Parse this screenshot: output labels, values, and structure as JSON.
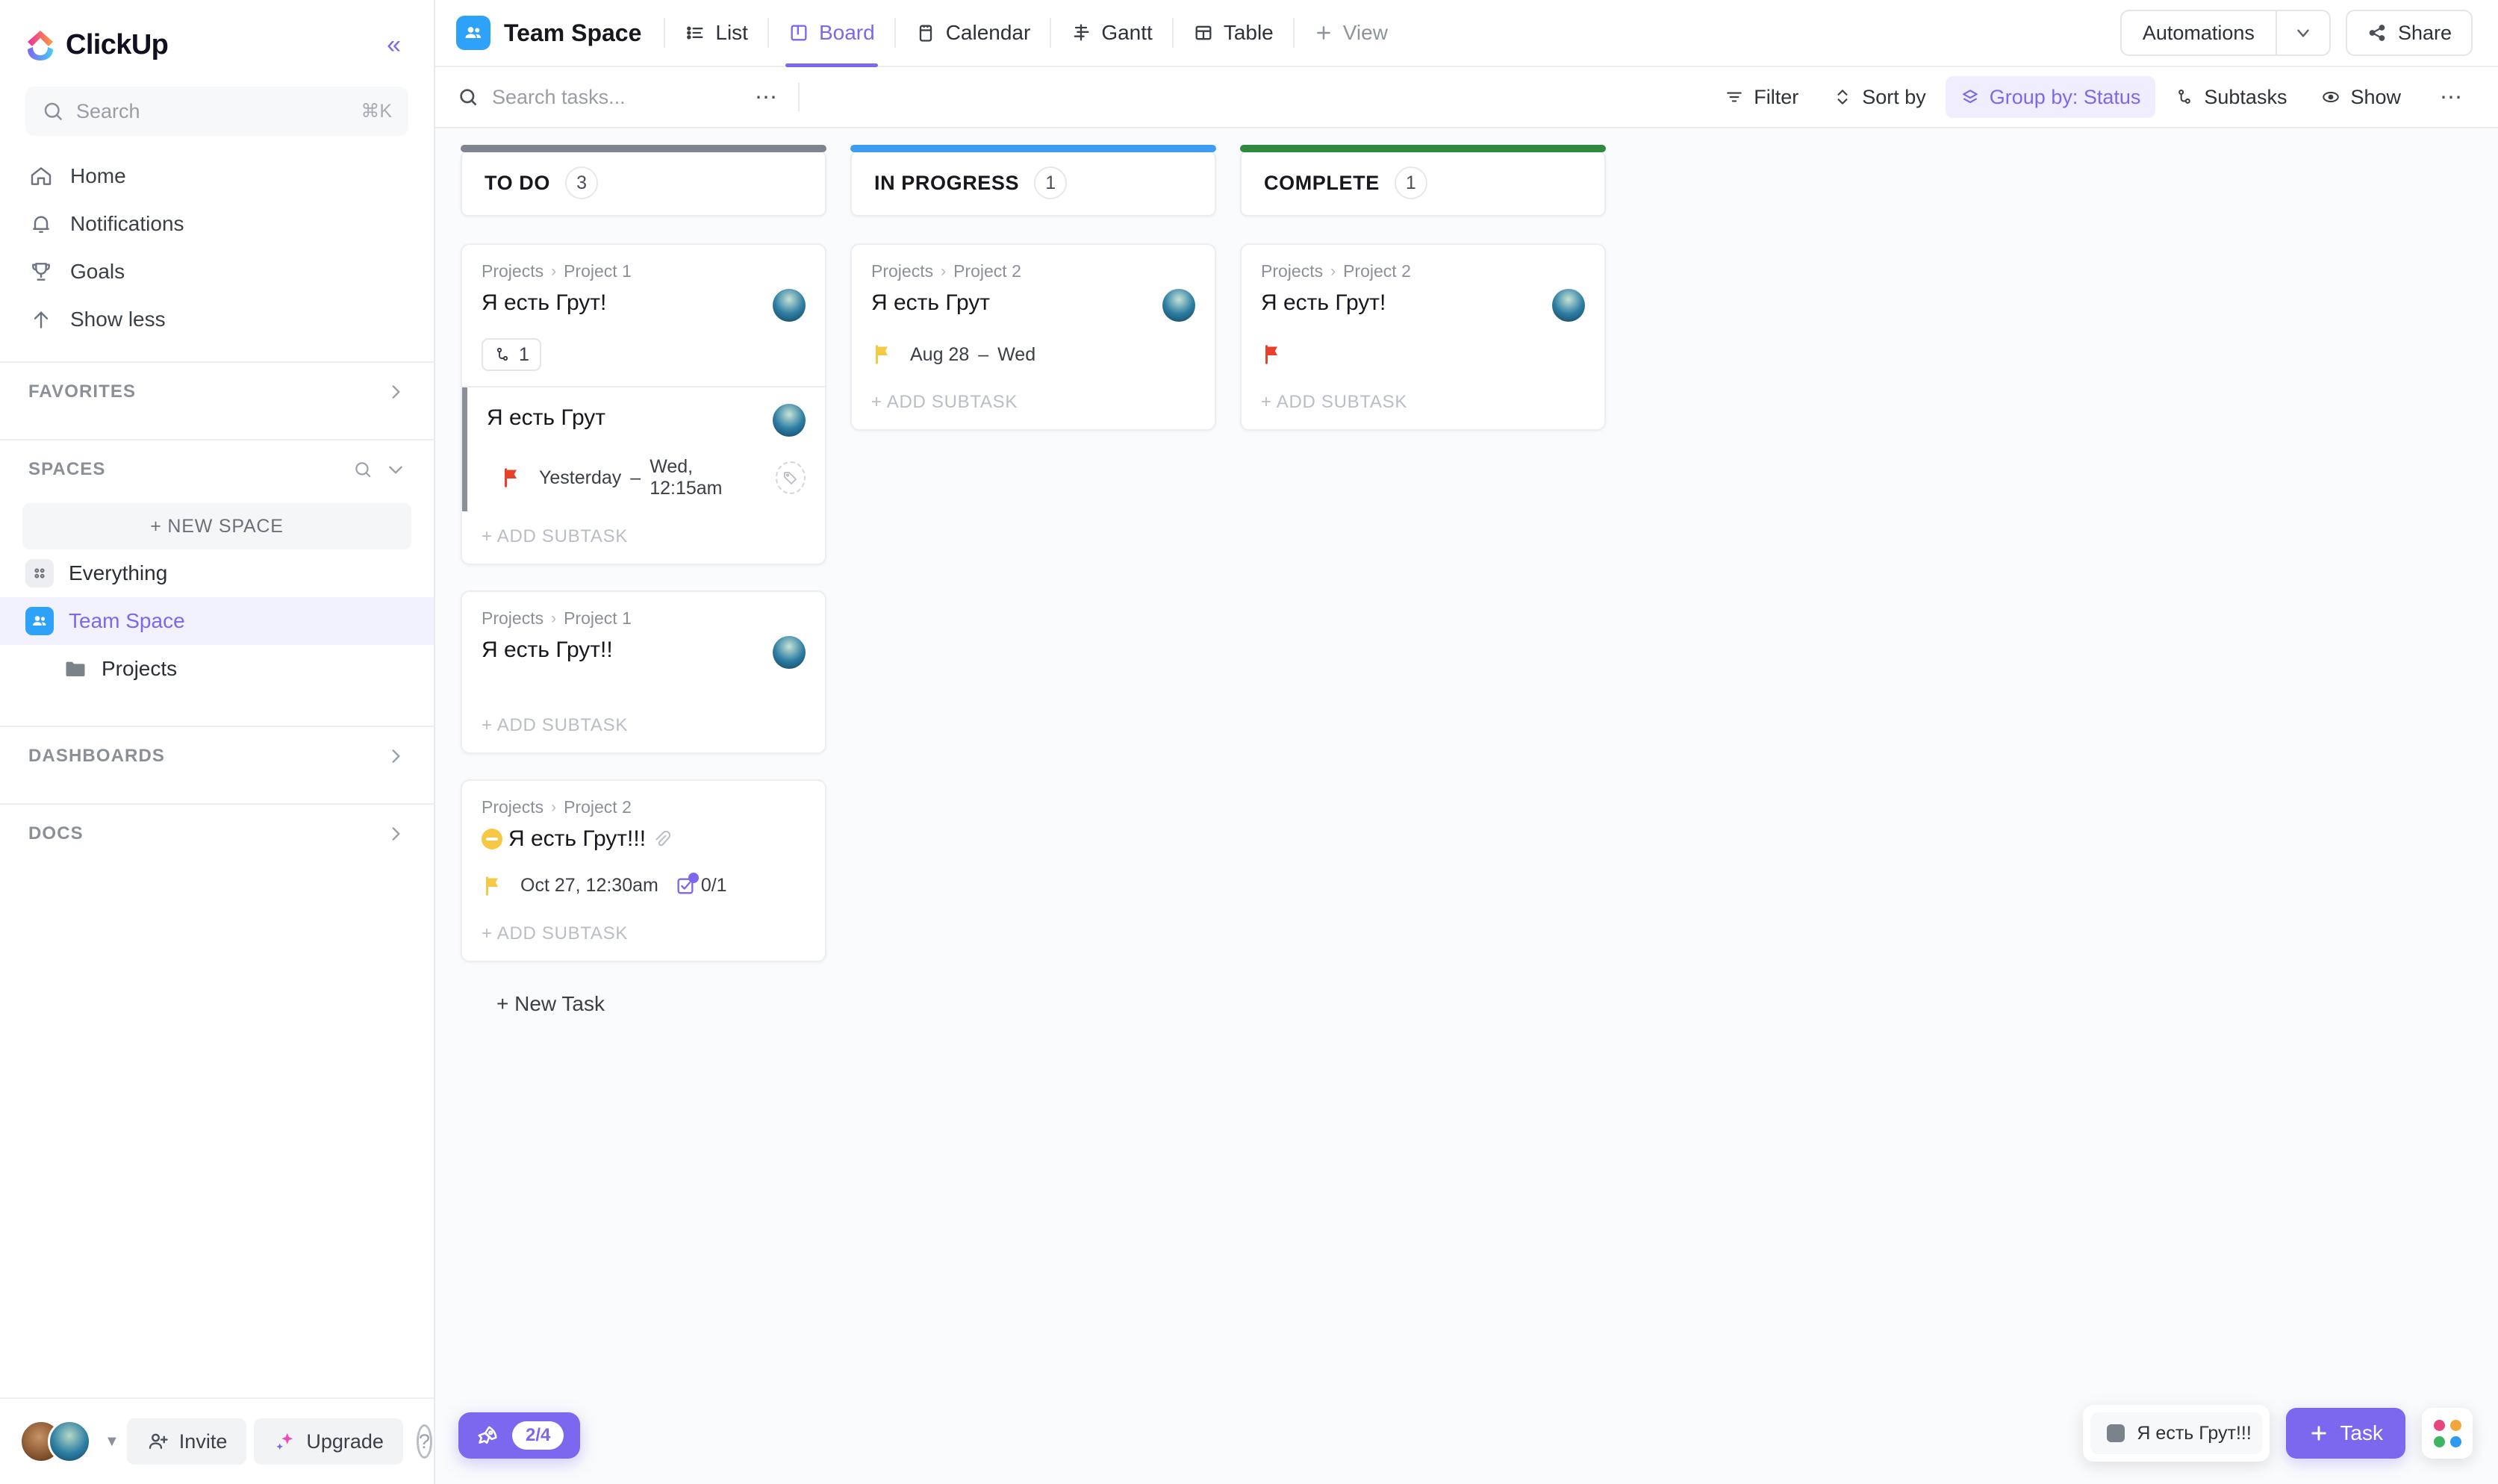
{
  "sidebar": {
    "brand": "ClickUp",
    "collapse_icon": "chevrons-left-icon",
    "search": {
      "placeholder": "Search",
      "shortcut": "⌘K",
      "icon": "search-icon"
    },
    "nav": [
      {
        "label": "Home",
        "icon": "home-icon"
      },
      {
        "label": "Notifications",
        "icon": "bell-icon"
      },
      {
        "label": "Goals",
        "icon": "trophy-icon"
      },
      {
        "label": "Show less",
        "icon": "arrow-up-icon"
      }
    ],
    "sections": {
      "favorites": {
        "label": "FAVORITES",
        "chevron": "chevron-right-icon"
      },
      "spaces": {
        "label": "SPACES",
        "search_icon": "search-icon",
        "chevron": "chevron-down-icon"
      },
      "dashboards": {
        "label": "DASHBOARDS",
        "chevron": "chevron-right-icon"
      },
      "docs": {
        "label": "DOCS",
        "chevron": "chevron-right-icon"
      }
    },
    "new_space": "+ NEW SPACE",
    "spaces": [
      {
        "label": "Everything",
        "icon": "grid-dots-icon",
        "active": false
      },
      {
        "label": "Team Space",
        "icon": "people-icon",
        "active": true
      }
    ],
    "folder": {
      "label": "Projects",
      "icon": "folder-icon"
    },
    "footer": {
      "invite": "Invite",
      "invite_icon": "user-plus-icon",
      "upgrade": "Upgrade",
      "upgrade_icon": "sparkle-icon",
      "help_icon": "question-circle-icon",
      "avatar_caret": "caret-down-icon"
    }
  },
  "topbar": {
    "space_name": "Team Space",
    "space_icon": "people-icon",
    "views": [
      {
        "label": "List",
        "icon": "list-icon",
        "active": false
      },
      {
        "label": "Board",
        "icon": "board-icon",
        "active": true
      },
      {
        "label": "Calendar",
        "icon": "calendar-icon",
        "active": false
      },
      {
        "label": "Gantt",
        "icon": "gantt-icon",
        "active": false
      },
      {
        "label": "Table",
        "icon": "table-icon",
        "active": false
      },
      {
        "label": "View",
        "icon": "plus-icon",
        "active": false
      }
    ],
    "automations": "Automations",
    "automations_caret": "chevron-down-icon",
    "share": "Share",
    "share_icon": "share-icon"
  },
  "subbar": {
    "search_placeholder": "Search tasks...",
    "search_icon": "search-icon",
    "more_icon": "ellipsis-icon",
    "controls": [
      {
        "label": "Filter",
        "icon": "filter-icon",
        "active": false
      },
      {
        "label": "Sort by",
        "icon": "sort-icon",
        "active": false
      },
      {
        "label": "Group by: Status",
        "icon": "layers-icon",
        "active": true
      },
      {
        "label": "Subtasks",
        "icon": "subtask-icon",
        "active": false
      },
      {
        "label": "Show",
        "icon": "eye-icon",
        "active": false
      }
    ],
    "overflow_icon": "ellipsis-icon"
  },
  "board": {
    "new_task_label": "+ New Task",
    "add_subtask_label": "+ ADD SUBTASK",
    "columns": [
      {
        "title": "TO DO",
        "count": "3",
        "accent": "#808490",
        "cards": [
          {
            "breadcrumb_root": "Projects",
            "breadcrumb_leaf": "Project 1",
            "title": "Я есть Грут!",
            "dependency_count": "1",
            "dependency_icon": "dependency-icon",
            "avatar": "groot-avatar",
            "subtask": {
              "title": "Я есть Грут",
              "flag": "red",
              "date": "Yesterday",
              "date_sep": "–",
              "time": "Wed, 12:15am",
              "tag_icon": "tag-icon",
              "avatar": "groot-avatar"
            }
          },
          {
            "breadcrumb_root": "Projects",
            "breadcrumb_leaf": "Project 1",
            "title": "Я есть Грут!!",
            "avatar": "groot-avatar"
          },
          {
            "breadcrumb_root": "Projects",
            "breadcrumb_leaf": "Project 2",
            "title": "Я есть Грут!!!",
            "emoji": "no-entry-emoji",
            "attachment_icon": "paperclip-icon",
            "flag": "yellow",
            "date": "Oct 27, 12:30am",
            "checklist": "0/1",
            "checklist_icon": "checkbox-icon"
          }
        ]
      },
      {
        "title": "IN PROGRESS",
        "count": "1",
        "accent": "#3e9cf3",
        "cards": [
          {
            "breadcrumb_root": "Projects",
            "breadcrumb_leaf": "Project 2",
            "title": "Я есть Грут",
            "avatar": "groot-avatar",
            "flag": "yellow",
            "date": "Aug 28",
            "date_sep": "–",
            "time": "Wed"
          }
        ]
      },
      {
        "title": "COMPLETE",
        "count": "1",
        "accent": "#2f8a40",
        "cards": [
          {
            "breadcrumb_root": "Projects",
            "breadcrumb_leaf": "Project 2",
            "title": "Я есть Грут!",
            "avatar": "groot-avatar",
            "flag": "red"
          }
        ]
      }
    ]
  },
  "floating": {
    "rocket_icon": "rocket-icon",
    "rocket_progress": "2/4",
    "mini_task_title": "Я есть Грут!!!",
    "task_button": "Task",
    "task_button_icon": "plus-icon",
    "apps_icon": "apps-grid-icon"
  },
  "colors": {
    "brand_purple": "#7b68ee",
    "accent_blue": "#2ea2f8",
    "todo_accent": "#808490",
    "inprogress_accent": "#3e9cf3",
    "complete_accent": "#2f8a40",
    "flag_red": "#e8402a",
    "flag_yellow": "#f5c945"
  }
}
